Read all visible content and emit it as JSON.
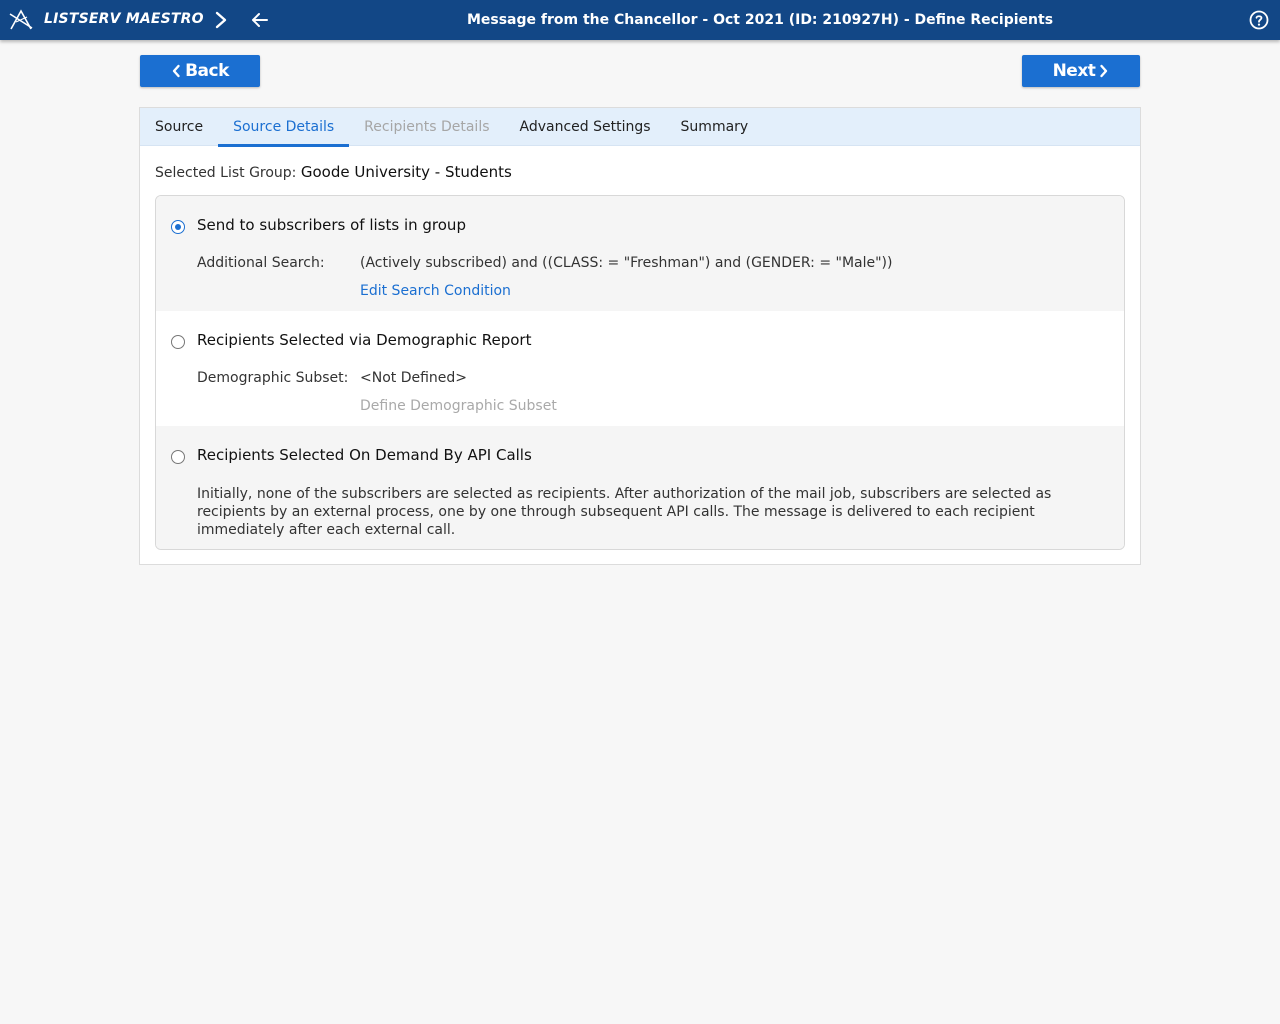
{
  "header": {
    "brand": "LISTSERV MAESTRO",
    "title": "Message from the Chancellor - Oct 2021 (ID: 210927H) - Define Recipients",
    "icons": [
      "maestro-logo-icon",
      "chevron-right-icon",
      "arrow-left-icon",
      "help-circle-icon"
    ]
  },
  "buttons": {
    "back_label": "Back",
    "next_label": "Next"
  },
  "tabs": [
    {
      "label": "Source",
      "state": "normal"
    },
    {
      "label": "Source Details",
      "state": "active"
    },
    {
      "label": "Recipients Details",
      "state": "disabled"
    },
    {
      "label": "Advanced Settings",
      "state": "normal"
    },
    {
      "label": "Summary",
      "state": "normal"
    }
  ],
  "selected_group": {
    "label": "Selected List Group:",
    "value": "Goode University - Students"
  },
  "options": [
    {
      "title": "Send to subscribers of lists in group",
      "checked": true,
      "field_label": "Additional Search:",
      "field_value": "(Actively subscribed) and ((CLASS: = \"Freshman\") and (GENDER: = \"Male\"))",
      "link": "Edit Search Condition"
    },
    {
      "title": "Recipients Selected via Demographic Report",
      "checked": false,
      "field_label": "Demographic Subset:",
      "field_value": "<Not Defined>",
      "link": "Define Demographic Subset"
    },
    {
      "title": "Recipients Selected On Demand By API Calls",
      "checked": false,
      "description": "Initially, none of the subscribers are selected as recipients. After authorization of the mail job, subscribers are selected as recipients by an external process, one by one through subsequent API calls. The message is delivered to each recipient immediately after each external call."
    }
  ],
  "colors": {
    "topbar": "#124786",
    "accent": "#1b6fd1",
    "tab_bar": "#e3effb",
    "disabled_text": "#a6a6a6"
  }
}
